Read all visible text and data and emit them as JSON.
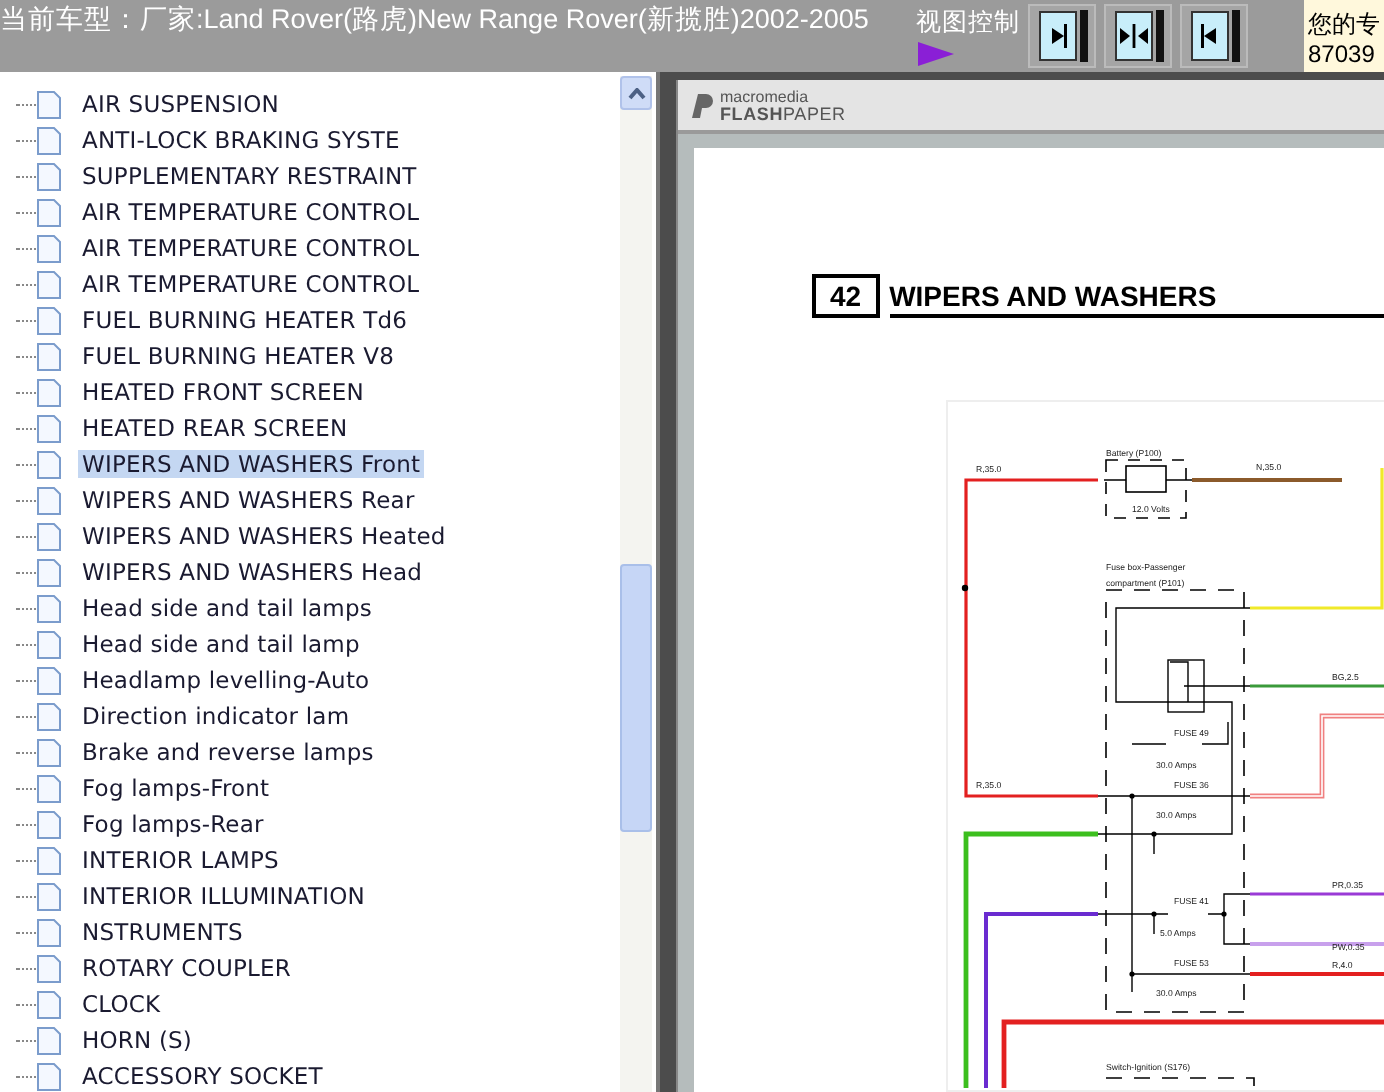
{
  "header": {
    "car_model": "当前车型：厂家:Land Rover(路虎)New Range Rover(新揽胜)2002-2005",
    "view_control": "视图控制",
    "view_buttons": [
      {
        "kind": "right"
      },
      {
        "kind": "both"
      },
      {
        "kind": "left"
      }
    ],
    "side_text": [
      "您的专",
      "87039"
    ]
  },
  "tree": {
    "items": [
      {
        "label": "AIR SUSPENSION",
        "selected": false
      },
      {
        "label": "ANTI-LOCK BRAKING SYSTE",
        "selected": false
      },
      {
        "label": "SUPPLEMENTARY RESTRAINT",
        "selected": false
      },
      {
        "label": "AIR TEMPERATURE CONTROL",
        "selected": false
      },
      {
        "label": "AIR TEMPERATURE CONTROL",
        "selected": false
      },
      {
        "label": "AIR TEMPERATURE CONTROL",
        "selected": false
      },
      {
        "label": "FUEL BURNING HEATER Td6",
        "selected": false
      },
      {
        "label": "FUEL BURNING HEATER V8",
        "selected": false
      },
      {
        "label": "HEATED FRONT SCREEN",
        "selected": false
      },
      {
        "label": "HEATED REAR SCREEN",
        "selected": false
      },
      {
        "label": "WIPERS AND WASHERS Front",
        "selected": true
      },
      {
        "label": "WIPERS AND WASHERS Rear",
        "selected": false
      },
      {
        "label": "WIPERS AND WASHERS Heated",
        "selected": false
      },
      {
        "label": "WIPERS AND WASHERS Head",
        "selected": false
      },
      {
        "label": "Head side and tail lamps",
        "selected": false
      },
      {
        "label": "Head side and tail lamp",
        "selected": false
      },
      {
        "label": "Headlamp levelling-Auto",
        "selected": false
      },
      {
        "label": "Direction indicator lam",
        "selected": false
      },
      {
        "label": "Brake and reverse lamps",
        "selected": false
      },
      {
        "label": "Fog lamps-Front",
        "selected": false
      },
      {
        "label": "Fog lamps-Rear",
        "selected": false
      },
      {
        "label": "INTERIOR LAMPS",
        "selected": false
      },
      {
        "label": "INTERIOR ILLUMINATION",
        "selected": false
      },
      {
        "label": "NSTRUMENTS",
        "selected": false
      },
      {
        "label": "ROTARY COUPLER",
        "selected": false
      },
      {
        "label": "CLOCK",
        "selected": false
      },
      {
        "label": "HORN (S)",
        "selected": false
      },
      {
        "label": "ACCESSORY SOCKET",
        "selected": false
      }
    ]
  },
  "viewer": {
    "brand_top": "macromedia",
    "brand_bold": "FLASH",
    "brand_light": "PAPER",
    "page": {
      "section_number": "42",
      "section_title": "WIPERS AND WASHERS",
      "diagram_labels": [
        "R,35.0",
        "Battery (P100)",
        "12.0 Volts",
        "N,35.0",
        "Fuse box-Passenger",
        "compartment (P101)",
        "BG,2.5",
        "FUSE 49",
        "30.0 Amps",
        "R,35.0",
        "FUSE 36",
        "30.0 Amps",
        "FUSE 41",
        "5.0 Amps",
        "PR,0.35",
        "PW,0.35",
        "R,4.0",
        "FUSE 53",
        "30.0 Amps",
        "Switch-Ignition (S176)"
      ]
    }
  }
}
